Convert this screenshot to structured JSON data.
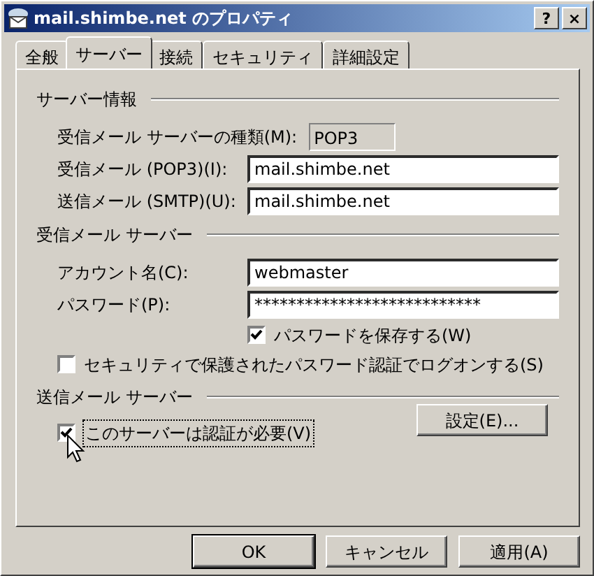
{
  "window": {
    "title": "mail.shimbe.net のプロパティ",
    "buttons": [
      "?",
      "×"
    ]
  },
  "tabs": [
    {
      "label": "全般",
      "selected": false
    },
    {
      "label": "サーバー",
      "selected": true
    },
    {
      "label": "接続",
      "selected": false
    },
    {
      "label": "セキュリティ",
      "selected": false
    },
    {
      "label": "詳細設定",
      "selected": false
    }
  ],
  "server_info": {
    "heading": "サーバー情報",
    "rows": [
      {
        "label": "受信メール サーバーの種類(M):",
        "value": "POP3",
        "kind": "readonly"
      },
      {
        "label": "受信メール (POP3)(I):",
        "value": "mail.shimbe.net",
        "kind": "input"
      },
      {
        "label": "送信メール (SMTP)(U):",
        "value": "mail.shimbe.net",
        "kind": "input"
      }
    ]
  },
  "incoming": {
    "heading": "受信メール サーバー",
    "rows": [
      {
        "label": "アカウント名(C):",
        "value": "webmaster",
        "kind": "input"
      },
      {
        "label": "パスワード(P):",
        "value": "***************************",
        "kind": "input"
      }
    ],
    "save_password": {
      "label": "パスワードを保存する(W)",
      "checked": true
    },
    "secure_logon": {
      "label": "セキュリティで保護されたパスワード認証でログオンする(S)",
      "checked": false
    }
  },
  "outgoing": {
    "heading": "送信メール サーバー",
    "auth": {
      "label": "このサーバーは認証が必要(V)",
      "checked": true
    },
    "settings_button": "設定(E)..."
  },
  "buttons": [
    "OK",
    "キャンセル",
    "適用(A)"
  ]
}
